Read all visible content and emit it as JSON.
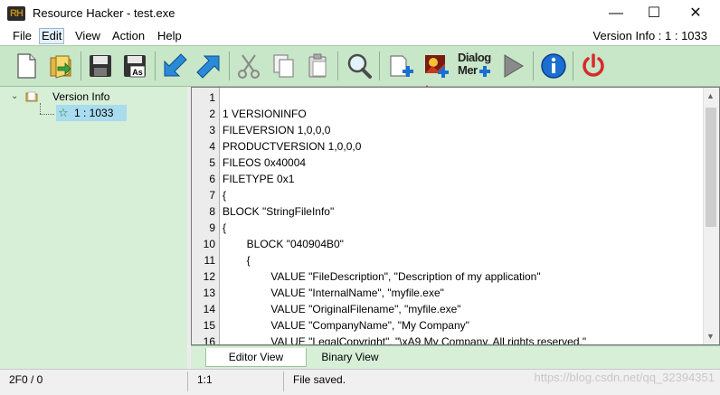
{
  "window": {
    "app_icon_label": "RH",
    "title": "Resource Hacker - test.exe",
    "minimize_glyph": "—",
    "maximize_glyph": "☐",
    "close_glyph": "✕"
  },
  "menu": {
    "items": [
      {
        "label": "File",
        "active": false
      },
      {
        "label": "Edit",
        "active": true
      },
      {
        "label": "View",
        "active": false
      },
      {
        "label": "Action",
        "active": false
      },
      {
        "label": "Help",
        "active": false
      }
    ],
    "status": "Version Info : 1 : 1033"
  },
  "toolbar": {
    "buttons": [
      {
        "icon": "new-file-icon"
      },
      {
        "icon": "open-folder-icon"
      },
      {
        "icon": "save-icon"
      },
      {
        "icon": "save-as-icon",
        "label": "As"
      },
      {
        "icon": "back-arrow-icon"
      },
      {
        "icon": "forward-arrow-icon"
      },
      {
        "icon": "cut-scissors-icon"
      },
      {
        "icon": "copy-icon"
      },
      {
        "icon": "paste-icon"
      },
      {
        "icon": "search-icon"
      },
      {
        "icon": "add-blank-resource-icon"
      },
      {
        "icon": "add-image-resource-icon"
      },
      {
        "icon": "dialog-menu-icon",
        "label_line1": "Dialog",
        "label_line2": "Mer"
      },
      {
        "icon": "compile-run-icon"
      },
      {
        "icon": "info-icon"
      },
      {
        "icon": "power-icon"
      }
    ],
    "accent_red": "#d62b2b",
    "accent_blue": "#1a6fd1"
  },
  "tree": {
    "root": {
      "label": "Version Info",
      "expanded": true
    },
    "child": {
      "label": "1 : 1033",
      "selected": true
    }
  },
  "editor": {
    "lines": [
      {
        "n": "1",
        "text": ""
      },
      {
        "n": "2",
        "text": "1 VERSIONINFO"
      },
      {
        "n": "3",
        "text": "FILEVERSION 1,0,0,0"
      },
      {
        "n": "4",
        "text": "PRODUCTVERSION 1,0,0,0"
      },
      {
        "n": "5",
        "text": "FILEOS 0x40004"
      },
      {
        "n": "6",
        "text": "FILETYPE 0x1"
      },
      {
        "n": "7",
        "text": "{"
      },
      {
        "n": "8",
        "text": "BLOCK \"StringFileInfo\""
      },
      {
        "n": "9",
        "text": "{"
      },
      {
        "n": "10",
        "text": "\t\tBLOCK \"040904B0\""
      },
      {
        "n": "11",
        "text": "\t\t{"
      },
      {
        "n": "12",
        "text": "\t\t\t\tVALUE \"FileDescription\", \"Description of my application\""
      },
      {
        "n": "13",
        "text": "\t\t\t\tVALUE \"InternalName\", \"myfile.exe\""
      },
      {
        "n": "14",
        "text": "\t\t\t\tVALUE \"OriginalFilename\", \"myfile.exe\""
      },
      {
        "n": "15",
        "text": "\t\t\t\tVALUE \"CompanyName\", \"My Company\""
      },
      {
        "n": "16",
        "text": "\t\t\t\tVALUE \"LegalCopyright\", \"\\xA9 My Company. All rights reserved.\""
      }
    ]
  },
  "tabs": [
    {
      "label": "Editor View",
      "active": true
    },
    {
      "label": "Binary View",
      "active": false
    }
  ],
  "statusbar": {
    "offset": "2F0 / 0",
    "position": "1:1",
    "message": "File saved."
  },
  "watermark": "https://blog.csdn.net/qq_32394351"
}
